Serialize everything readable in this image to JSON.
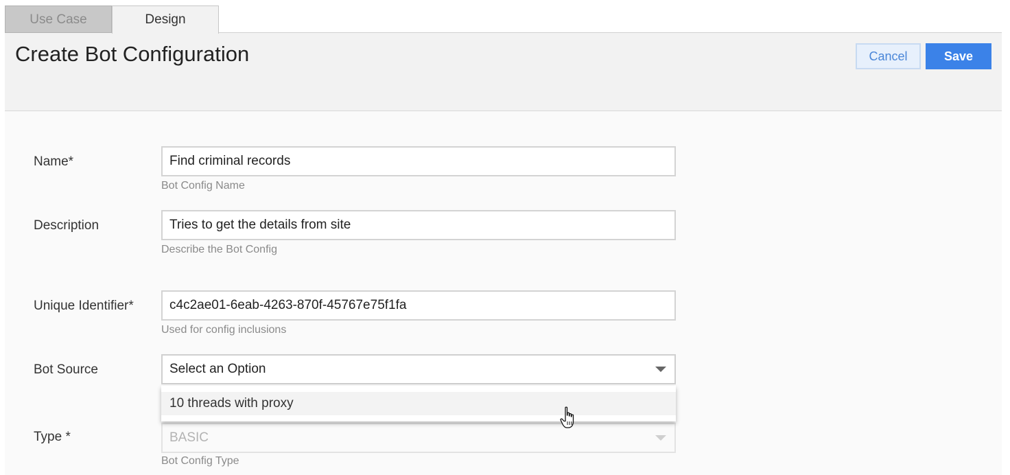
{
  "tabs": [
    {
      "label": "Use Case",
      "state": "inactive"
    },
    {
      "label": "Design",
      "state": "active"
    }
  ],
  "header": {
    "title": "Create Bot Configuration",
    "cancel_label": "Cancel",
    "save_label": "Save"
  },
  "form": {
    "name": {
      "label": "Name*",
      "value": "Find criminal records",
      "hint": "Bot Config Name"
    },
    "description": {
      "label": "Description",
      "value": "Tries to get the details from site",
      "hint": "Describe the Bot Config"
    },
    "unique_identifier": {
      "label": "Unique Identifier*",
      "value": "c4c2ae01-6eab-4263-870f-45767e75f1fa",
      "hint": "Used for config inclusions"
    },
    "bot_source": {
      "label": "Bot Source",
      "value": "Select an Option",
      "options": [
        "10 threads with proxy"
      ],
      "expanded": true
    },
    "type": {
      "label": "Type *",
      "value": "BASIC",
      "hint": "Bot Config Type",
      "disabled": true
    }
  },
  "colors": {
    "accent": "#3b82e8",
    "cancel_bg": "#e7f0fc",
    "header_bg": "#f2f2f2"
  },
  "cursor": {
    "icon": "hand-pointer-icon"
  }
}
